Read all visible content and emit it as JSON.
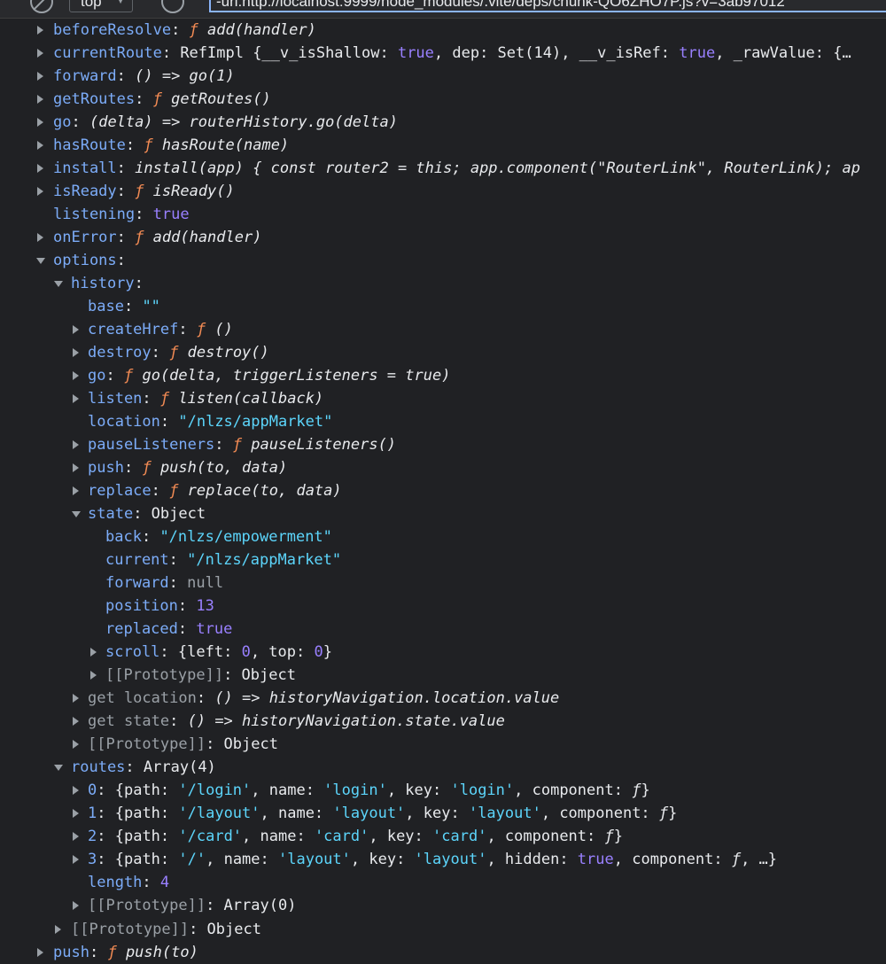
{
  "topbar": {
    "context": "top",
    "url": "-url:http://localhost:9999/node_modules/.vite/deps/chunk-QO6ZHO7P.js?v=3ab97012"
  },
  "rows": {
    "beforeResolve": {
      "key": "beforeResolve",
      "fn": "ƒ",
      "val": "add(handler)"
    },
    "currentRoute": {
      "key": "currentRoute",
      "p1": "RefImpl {__v_isShallow: ",
      "t1": "true",
      "p2": ", dep: Set(14), __v_isRef: ",
      "t2": "true",
      "p3": ", _rawValue: {…"
    },
    "forward": {
      "key": "forward",
      "val": "() => go(1)"
    },
    "getRoutes": {
      "key": "getRoutes",
      "fn": "ƒ",
      "val": "getRoutes()"
    },
    "go": {
      "key": "go",
      "val": "(delta) => routerHistory.go(delta)"
    },
    "hasRoute": {
      "key": "hasRoute",
      "fn": "ƒ",
      "val": "hasRoute(name)"
    },
    "install": {
      "key": "install",
      "val": "install(app) { const router2 = this; app.component(\"RouterLink\", RouterLink); ap"
    },
    "isReady": {
      "key": "isReady",
      "fn": "ƒ",
      "val": "isReady()"
    },
    "listening": {
      "key": "listening",
      "val": "true"
    },
    "onError": {
      "key": "onError",
      "fn": "ƒ",
      "val": "add(handler)"
    },
    "options": {
      "key": "options"
    },
    "history": {
      "key": "history"
    },
    "base": {
      "key": "base",
      "val": "\"\""
    },
    "createHref": {
      "key": "createHref",
      "fn": "ƒ",
      "val": "()"
    },
    "destroy": {
      "key": "destroy",
      "fn": "ƒ",
      "val": "destroy()"
    },
    "hgo": {
      "key": "go",
      "fn": "ƒ",
      "val": "go(delta, triggerListeners = true)"
    },
    "listen": {
      "key": "listen",
      "fn": "ƒ",
      "val": "listen(callback)"
    },
    "location": {
      "key": "location",
      "val": "\"/nlzs/appMarket\""
    },
    "pauseListeners": {
      "key": "pauseListeners",
      "fn": "ƒ",
      "val": "pauseListeners()"
    },
    "push": {
      "key": "push",
      "fn": "ƒ",
      "val": "push(to, data)"
    },
    "replace": {
      "key": "replace",
      "fn": "ƒ",
      "val": "replace(to, data)"
    },
    "state": {
      "key": "state",
      "val": "Object"
    },
    "back": {
      "key": "back",
      "val": "\"/nlzs/empowerment\""
    },
    "current": {
      "key": "current",
      "val": "\"/nlzs/appMarket\""
    },
    "sforward": {
      "key": "forward",
      "val": "null"
    },
    "position": {
      "key": "position",
      "val": "13"
    },
    "replaced": {
      "key": "replaced",
      "val": "true"
    },
    "scroll": {
      "key": "scroll",
      "p1": "{left: ",
      "n1": "0",
      "p2": ", top: ",
      "n2": "0",
      "p3": "}"
    },
    "proto1": {
      "key": "[[Prototype]]",
      "val": "Object"
    },
    "getLocation": {
      "key": "get location",
      "val": "() => historyNavigation.location.value"
    },
    "getState": {
      "key": "get state",
      "val": "() => historyNavigation.state.value"
    },
    "proto2": {
      "key": "[[Prototype]]",
      "val": "Object"
    },
    "routes": {
      "key": "routes",
      "val": "Array(4)"
    },
    "r0": {
      "key": "0",
      "a": "{path: ",
      "path": "'/login'",
      "b": ", name: ",
      "name": "'login'",
      "c": ", key: ",
      "rkey": "'login'",
      "d": ", component: ",
      "fn": "ƒ",
      "e": "}"
    },
    "r1": {
      "key": "1",
      "a": "{path: ",
      "path": "'/layout'",
      "b": ", name: ",
      "name": "'layout'",
      "c": ", key: ",
      "rkey": "'layout'",
      "d": ", component: ",
      "fn": "ƒ",
      "e": "}"
    },
    "r2": {
      "key": "2",
      "a": "{path: ",
      "path": "'/card'",
      "b": ", name: ",
      "name": "'card'",
      "c": ", key: ",
      "rkey": "'card'",
      "d": ", component: ",
      "fn": "ƒ",
      "e": "}"
    },
    "r3": {
      "key": "3",
      "a": "{path: ",
      "path": "'/'",
      "b": ", name: ",
      "name": "'layout'",
      "c": ", key: ",
      "rkey": "'layout'",
      "h": ", hidden: ",
      "hidden": "true",
      "d": ", component: ",
      "fn": "ƒ",
      "e": ", …}"
    },
    "length": {
      "key": "length",
      "val": "4"
    },
    "proto3": {
      "key": "[[Prototype]]",
      "val": "Array(0)"
    },
    "proto4": {
      "key": "[[Prototype]]",
      "val": "Object"
    },
    "rpush": {
      "key": "push",
      "fn": "ƒ",
      "val": "push(to)"
    }
  }
}
